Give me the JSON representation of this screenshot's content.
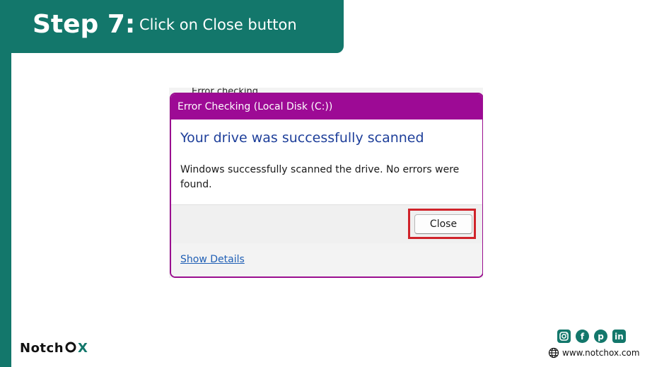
{
  "step": {
    "number": "Step 7:",
    "instruction": "Click on Close button"
  },
  "screenshot": {
    "background_text": "Error checking",
    "dialog": {
      "title": "Error Checking (Local Disk (C:))",
      "heading": "Your drive was successfully scanned",
      "message": "Windows successfully scanned the drive. No errors were found.",
      "close_button": "Close",
      "show_details": "Show Details"
    }
  },
  "branding": {
    "logo_part1": "Notch",
    "logo_part2": "X",
    "website": "www.notchox.com",
    "social": [
      "instagram-icon",
      "facebook-icon",
      "pinterest-icon",
      "linkedin-icon"
    ]
  },
  "colors": {
    "brand_teal": "#13776b",
    "dialog_accent": "#9d0a95",
    "highlight_red": "#d0232a"
  }
}
